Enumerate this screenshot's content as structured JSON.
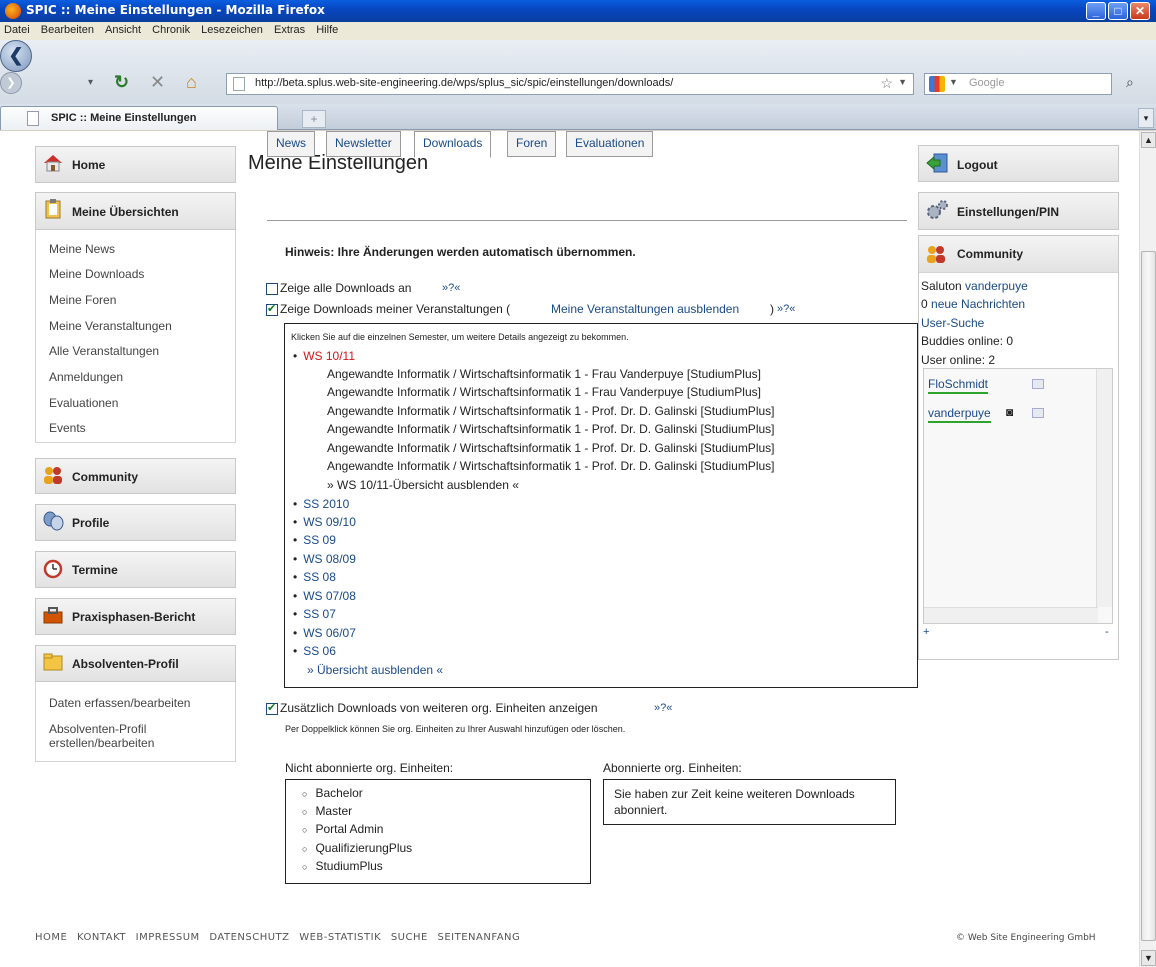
{
  "window": {
    "title": "SPIC :: Meine Einstellungen - Mozilla Firefox"
  },
  "menu": [
    "Datei",
    "Bearbeiten",
    "Ansicht",
    "Chronik",
    "Lesezeichen",
    "Extras",
    "Hilfe"
  ],
  "browser": {
    "url": "http://beta.splus.web-site-engineering.de/wps/splus_sic/spic/einstellungen/downloads/",
    "search_placeholder": "Google",
    "tab_title": "SPIC :: Meine Einstellungen"
  },
  "left": {
    "home": "Home",
    "overview": "Meine Übersichten",
    "overview_items": [
      "Meine News",
      "Meine Downloads",
      "Meine Foren",
      "Meine Veranstaltungen",
      "Alle Veranstaltungen",
      "Anmeldungen",
      "Evaluationen",
      "Events"
    ],
    "community": "Community",
    "profile": "Profile",
    "termine": "Termine",
    "praxis": "Praxisphasen-Bericht",
    "absolventen": "Absolventen-Profil",
    "absolventen_items": [
      "Daten erfassen/bearbeiten",
      "Absolventen-Profil erstellen/bearbeiten"
    ]
  },
  "main": {
    "title": "Meine Einstellungen",
    "tabs": [
      "News",
      "Newsletter",
      "Downloads",
      "Foren",
      "Evaluationen"
    ],
    "active_tab": "Downloads",
    "hint": "Hinweis: Ihre Änderungen werden automatisch übernommen.",
    "opt1": "Zeige alle Downloads an",
    "opt1_checked": false,
    "help": "»?«",
    "opt2_prefix": "Zeige Downloads meiner Veranstaltungen (",
    "opt2_link": "Meine Veranstaltungen ausblenden",
    "opt2_suffix": ")",
    "opt2_checked": true,
    "box_note": "Klicken Sie auf die einzelnen Semester, um weitere Details angezeigt zu bekommen.",
    "current_semester": "WS 10/11",
    "courses": [
      "Angewandte Informatik / Wirtschaftsinformatik 1 - Frau Vanderpuye [StudiumPlus]",
      "Angewandte Informatik / Wirtschaftsinformatik 1 - Frau Vanderpuye [StudiumPlus]",
      "Angewandte Informatik / Wirtschaftsinformatik 1 - Prof. Dr. D. Galinski [StudiumPlus]",
      "Angewandte Informatik / Wirtschaftsinformatik 1 - Prof. Dr. D. Galinski [StudiumPlus]",
      "Angewandte Informatik / Wirtschaftsinformatik 1 - Prof. Dr. D. Galinski [StudiumPlus]",
      "Angewandte Informatik / Wirtschaftsinformatik 1 - Prof. Dr. D. Galinski [StudiumPlus]"
    ],
    "hide_semester": "» WS 10/11-Übersicht ausblenden «",
    "semesters": [
      "SS 2010",
      "WS 09/10",
      "SS 09",
      "WS 08/09",
      "SS 08",
      "WS 07/08",
      "SS 07",
      "WS 06/07",
      "SS 06"
    ],
    "hide_all": "» Übersicht ausblenden «",
    "opt3": "Zusätzlich Downloads von weiteren org. Einheiten anzeigen",
    "opt3_checked": true,
    "opt3_note": "Per Doppelklick können Sie org. Einheiten zu Ihrer Auswahl hinzufügen oder löschen.",
    "not_subscribed_label": "Nicht abonnierte org. Einheiten:",
    "not_subscribed": [
      "Bachelor",
      "Master",
      "Portal Admin",
      "QualifizierungPlus",
      "StudiumPlus"
    ],
    "subscribed_label": "Abonnierte org. Einheiten:",
    "subscribed_empty": "Sie haben zur Zeit keine weiteren Downloads abonniert."
  },
  "right": {
    "logout": "Logout",
    "settings": "Einstellungen/PIN",
    "community": "Community",
    "greeting": "Saluton",
    "user": "vanderpuye",
    "messages_count": "0",
    "messages_label": "neue Nachrichten",
    "user_search": "User-Suche",
    "buddies_online": "Buddies online: 0",
    "users_online": "User online: 2",
    "buddies": [
      "FloSchmidt",
      "vanderpuye"
    ],
    "plus": "+",
    "minus": "-"
  },
  "footer": {
    "links": [
      "HOME",
      "KONTAKT",
      "IMPRESSUM",
      "DATENSCHUTZ",
      "WEB-STATISTIK",
      "SUCHE",
      "SEITENANFANG"
    ],
    "copyright": "© Web Site Engineering GmbH"
  }
}
